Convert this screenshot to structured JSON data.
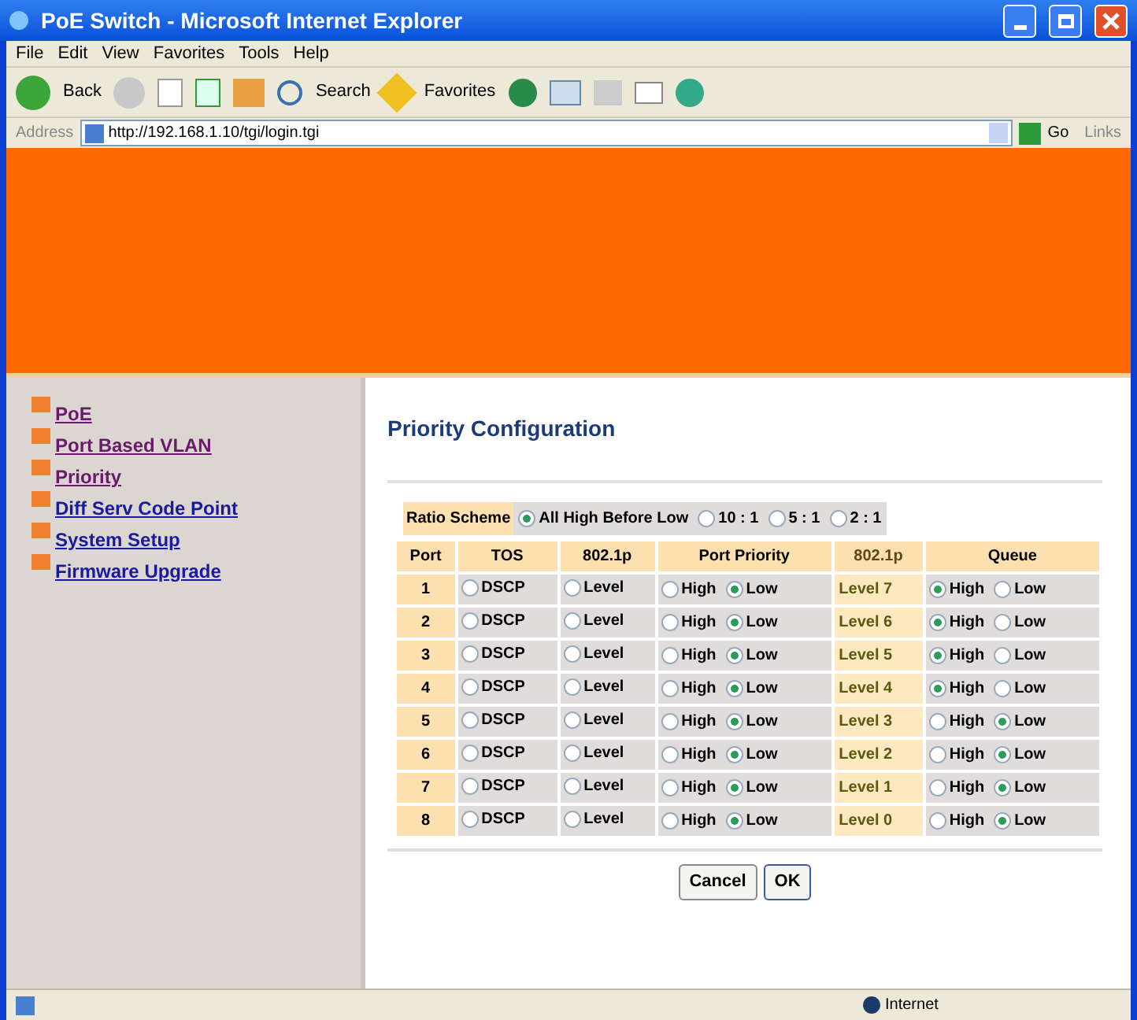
{
  "window": {
    "title": "PoE Switch - Microsoft Internet Explorer"
  },
  "menu": [
    "File",
    "Edit",
    "View",
    "Favorites",
    "Tools",
    "Help"
  ],
  "toolbar": {
    "back": "Back",
    "search": "Search",
    "favorites": "Favorites"
  },
  "address": {
    "label": "Address",
    "value": "http://192.168.1.10/tgi/login.tgi",
    "go": "Go",
    "links": "Links"
  },
  "sidebar": {
    "items": [
      {
        "label": "PoE",
        "visited": true
      },
      {
        "label": "Port Based VLAN",
        "visited": true
      },
      {
        "label": "Priority",
        "visited": true
      },
      {
        "label": "Diff Serv Code Point",
        "visited": false
      },
      {
        "label": "System Setup",
        "visited": false
      },
      {
        "label": "Firmware Upgrade",
        "visited": false
      }
    ]
  },
  "page": {
    "title": "Priority Configuration",
    "ratio": {
      "label": "Ratio Scheme",
      "options": [
        {
          "label": "All High Before Low",
          "selected": true
        },
        {
          "label": "10 : 1",
          "selected": false
        },
        {
          "label": "5 : 1",
          "selected": false
        },
        {
          "label": "2 : 1",
          "selected": false
        }
      ]
    },
    "columns": [
      "Port",
      "TOS",
      "802.1p",
      "Port Priority",
      "802.1p",
      "Queue"
    ],
    "rows": [
      {
        "port": "1",
        "tos": {
          "label": "DSCP",
          "checked": false
        },
        "dot1p": {
          "label": "Level",
          "checked": false
        },
        "priority": [
          {
            "label": "High",
            "selected": false
          },
          {
            "label": "Low",
            "selected": true
          }
        ],
        "level": "Level 7",
        "queue": [
          {
            "label": "High",
            "selected": true
          },
          {
            "label": "Low",
            "selected": false
          }
        ]
      },
      {
        "port": "2",
        "tos": {
          "label": "DSCP",
          "checked": false
        },
        "dot1p": {
          "label": "Level",
          "checked": false
        },
        "priority": [
          {
            "label": "High",
            "selected": false
          },
          {
            "label": "Low",
            "selected": true
          }
        ],
        "level": "Level 6",
        "queue": [
          {
            "label": "High",
            "selected": true
          },
          {
            "label": "Low",
            "selected": false
          }
        ]
      },
      {
        "port": "3",
        "tos": {
          "label": "DSCP",
          "checked": false
        },
        "dot1p": {
          "label": "Level",
          "checked": false
        },
        "priority": [
          {
            "label": "High",
            "selected": false
          },
          {
            "label": "Low",
            "selected": true
          }
        ],
        "level": "Level 5",
        "queue": [
          {
            "label": "High",
            "selected": true
          },
          {
            "label": "Low",
            "selected": false
          }
        ]
      },
      {
        "port": "4",
        "tos": {
          "label": "DSCP",
          "checked": false
        },
        "dot1p": {
          "label": "Level",
          "checked": false
        },
        "priority": [
          {
            "label": "High",
            "selected": false
          },
          {
            "label": "Low",
            "selected": true
          }
        ],
        "level": "Level 4",
        "queue": [
          {
            "label": "High",
            "selected": true
          },
          {
            "label": "Low",
            "selected": false
          }
        ]
      },
      {
        "port": "5",
        "tos": {
          "label": "DSCP",
          "checked": false
        },
        "dot1p": {
          "label": "Level",
          "checked": false
        },
        "priority": [
          {
            "label": "High",
            "selected": false
          },
          {
            "label": "Low",
            "selected": true
          }
        ],
        "level": "Level 3",
        "queue": [
          {
            "label": "High",
            "selected": false
          },
          {
            "label": "Low",
            "selected": true
          }
        ]
      },
      {
        "port": "6",
        "tos": {
          "label": "DSCP",
          "checked": false
        },
        "dot1p": {
          "label": "Level",
          "checked": false
        },
        "priority": [
          {
            "label": "High",
            "selected": false
          },
          {
            "label": "Low",
            "selected": true
          }
        ],
        "level": "Level 2",
        "queue": [
          {
            "label": "High",
            "selected": false
          },
          {
            "label": "Low",
            "selected": true
          }
        ]
      },
      {
        "port": "7",
        "tos": {
          "label": "DSCP",
          "checked": false
        },
        "dot1p": {
          "label": "Level",
          "checked": false
        },
        "priority": [
          {
            "label": "High",
            "selected": false
          },
          {
            "label": "Low",
            "selected": true
          }
        ],
        "level": "Level 1",
        "queue": [
          {
            "label": "High",
            "selected": false
          },
          {
            "label": "Low",
            "selected": true
          }
        ]
      },
      {
        "port": "8",
        "tos": {
          "label": "DSCP",
          "checked": false
        },
        "dot1p": {
          "label": "Level",
          "checked": false
        },
        "priority": [
          {
            "label": "High",
            "selected": false
          },
          {
            "label": "Low",
            "selected": true
          }
        ],
        "level": "Level 0",
        "queue": [
          {
            "label": "High",
            "selected": false
          },
          {
            "label": "Low",
            "selected": true
          }
        ]
      }
    ],
    "buttons": [
      "Cancel",
      "OK"
    ]
  },
  "status_bar": {
    "zone": "Internet"
  }
}
